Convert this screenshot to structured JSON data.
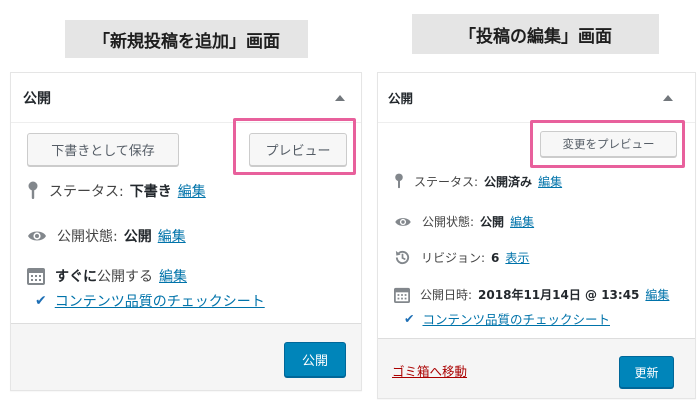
{
  "captions": {
    "left": "「新規投稿を追加」画面",
    "right": "「投稿の編集」画面"
  },
  "new_post": {
    "title": "公開",
    "save_draft_label": "下書きとして保存",
    "preview_label": "プレビュー",
    "status_label": "ステータス:",
    "status_value": "下書き",
    "status_edit": "編集",
    "visibility_label": "公開状態:",
    "visibility_value": "公開",
    "visibility_edit": "編集",
    "schedule_bold": "すぐに",
    "schedule_text": "公開する",
    "schedule_edit": "編集",
    "checklist_link": "コンテンツ品質のチェックシート",
    "publish_label": "公開"
  },
  "edit_post": {
    "title": "公開",
    "preview_changes_label": "変更をプレビュー",
    "status_label": "ステータス:",
    "status_value": "公開済み",
    "status_edit": "編集",
    "visibility_label": "公開状態:",
    "visibility_value": "公開",
    "visibility_edit": "編集",
    "revisions_label": "リビジョン:",
    "revisions_value": "6",
    "revisions_link": "表示",
    "published_label": "公開日時:",
    "published_value": "2018年11月14日 @ 13:45",
    "published_edit": "編集",
    "checklist_link": "コンテンツ品質のチェックシート",
    "trash_label": "ゴミ箱へ移動",
    "update_label": "更新"
  },
  "colors": {
    "highlight": "#e8609c",
    "primary": "#0085ba",
    "link": "#0073aa",
    "trash": "#aa0000"
  },
  "icons": {
    "status": "pin-icon",
    "visibility": "eye-icon",
    "schedule": "calendar-icon",
    "revisions": "history-icon",
    "checklist": "checkmark-icon",
    "toggle": "triangle-up-icon"
  }
}
